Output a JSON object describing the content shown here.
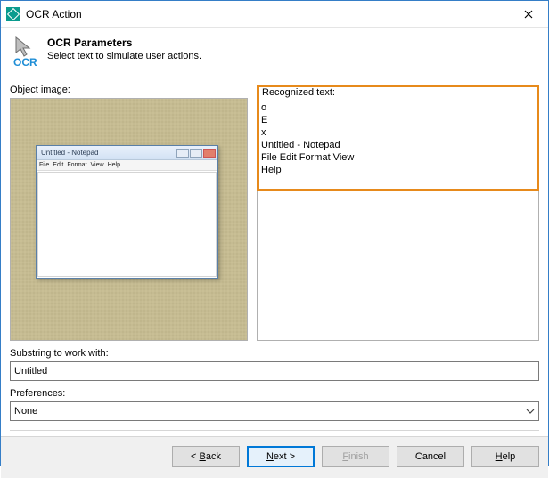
{
  "window": {
    "title": "OCR Action"
  },
  "header": {
    "title": "OCR Parameters",
    "subtitle": "Select text to simulate user actions."
  },
  "panels": {
    "object_image_label": "Object image:",
    "recognized_label": "Recognized text:",
    "recognized_text": "o\nE\nx\nUntitled - Notepad\nFile Edit Format View\nHelp"
  },
  "thumbnail": {
    "title": "Untitled - Notepad",
    "menu": [
      "File",
      "Edit",
      "Format",
      "View",
      "Help"
    ]
  },
  "substring": {
    "label": "Substring to work with:",
    "value": "Untitled"
  },
  "preferences": {
    "label": "Preferences:",
    "value": "None"
  },
  "buttons": {
    "back": "< Back",
    "next": "Next >",
    "finish": "Finish",
    "cancel": "Cancel",
    "help": "Help"
  }
}
